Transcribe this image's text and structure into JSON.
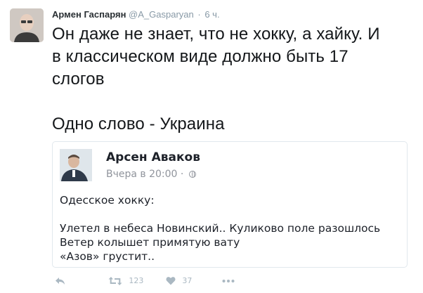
{
  "tweet": {
    "author_name": "Армен Гаспарян",
    "handle": "@A_Gasparyan",
    "separator": "·",
    "time": "6 ч.",
    "text_lines": [
      "Он даже не знает, что не хокку, а хайку. И",
      "в классическом виде должно быть 17",
      "слогов"
    ],
    "text_last": "Одно слово - Украина"
  },
  "card": {
    "name": "Арсен Аваков",
    "meta": "Вчера в 20:00 ·",
    "lines_top": [
      "Одесское хокку:"
    ],
    "lines_bottom": [
      "Улетел в небеса Новинский.. Куликово поле разошлось",
      "Ветер колышет примятую вату",
      "«Азов» грустит.."
    ]
  },
  "actions": {
    "retweet_count": "123",
    "like_count": "37"
  },
  "colors": {
    "muted": "#8899a6",
    "icon": "#aab8c2",
    "text": "#14171a",
    "border": "#e1e8ed"
  }
}
